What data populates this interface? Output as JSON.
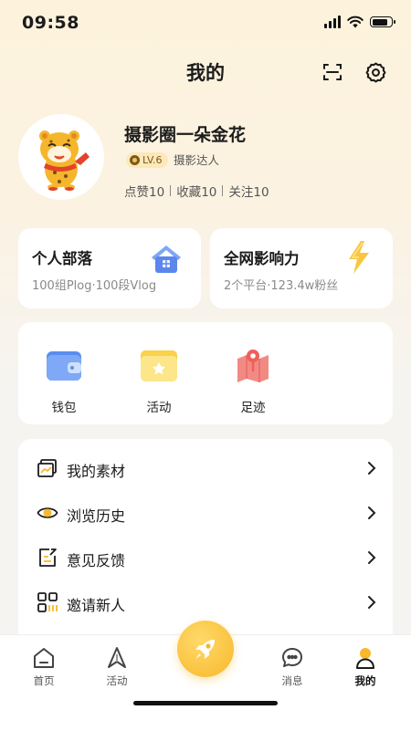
{
  "status_bar": {
    "time": "09:58"
  },
  "header": {
    "title": "我的",
    "scan_icon": "scan-icon",
    "settings_icon": "gear-icon"
  },
  "profile": {
    "username": "摄影圈一朵金花",
    "level": "LV.6",
    "level_title": "摄影达人",
    "stats": [
      {
        "label": "点赞",
        "value": "10"
      },
      {
        "label": "收藏",
        "value": "10"
      },
      {
        "label": "关注",
        "value": "10"
      }
    ]
  },
  "cards": {
    "tribe": {
      "title": "个人部落",
      "subtitle": "100组Plog·100段Vlog",
      "icon": "house-icon"
    },
    "influence": {
      "title": "全网影响力",
      "subtitle": "2个平台·123.4w粉丝",
      "icon": "lightning-icon"
    }
  },
  "quick_actions": [
    {
      "label": "钱包",
      "icon": "wallet-icon"
    },
    {
      "label": "活动",
      "icon": "event-folder-icon"
    },
    {
      "label": "足迹",
      "icon": "map-pin-icon"
    }
  ],
  "menu": [
    {
      "label": "我的素材",
      "icon": "chart-board-icon"
    },
    {
      "label": "浏览历史",
      "icon": "eye-icon"
    },
    {
      "label": "意见反馈",
      "icon": "edit-note-icon"
    },
    {
      "label": "邀请新人",
      "icon": "grid-invite-icon"
    }
  ],
  "tab_bar": {
    "tabs": [
      {
        "label": "首页",
        "icon": "home-icon"
      },
      {
        "label": "活动",
        "icon": "navigation-arrow-icon"
      },
      {
        "label": "消息",
        "icon": "chat-bubble-icon"
      },
      {
        "label": "我的",
        "icon": "person-icon"
      }
    ],
    "active": "我的",
    "center_button_icon": "rocket-icon"
  },
  "colors": {
    "accent": "#f7b82a",
    "background": "#f5f4f2",
    "header_gradient": "#fdf3dc"
  }
}
